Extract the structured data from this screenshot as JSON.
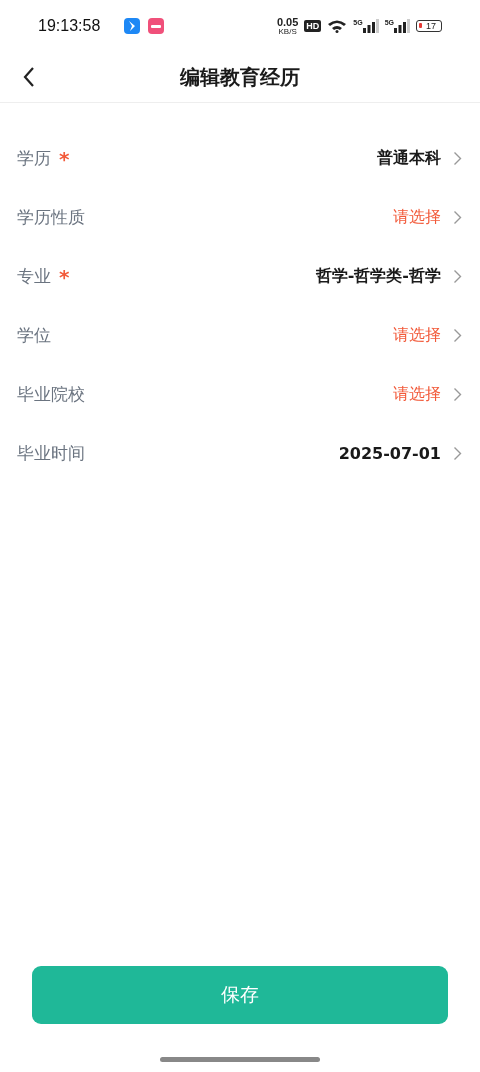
{
  "status_bar": {
    "time": "19:13:58",
    "net_speed": "0.05",
    "net_unit": "KB/S",
    "battery": "17",
    "signal_label_1": "5G",
    "signal_label_2": "5G",
    "hd_label": "HD"
  },
  "header": {
    "title": "编辑教育经历"
  },
  "fields": [
    {
      "label": "学历",
      "required": true,
      "kind": "value",
      "value": "普通本科"
    },
    {
      "label": "学历性质",
      "required": false,
      "kind": "prompt",
      "value": "请选择"
    },
    {
      "label": "专业",
      "required": true,
      "kind": "value",
      "value": "哲学-哲学类-哲学"
    },
    {
      "label": "学位",
      "required": false,
      "kind": "prompt",
      "value": "请选择"
    },
    {
      "label": "毕业院校",
      "required": false,
      "kind": "prompt",
      "value": "请选择"
    },
    {
      "label": "毕业时间",
      "required": false,
      "kind": "value",
      "value": "2025-07-01"
    }
  ],
  "required_mark": "*",
  "save_button": "保存"
}
